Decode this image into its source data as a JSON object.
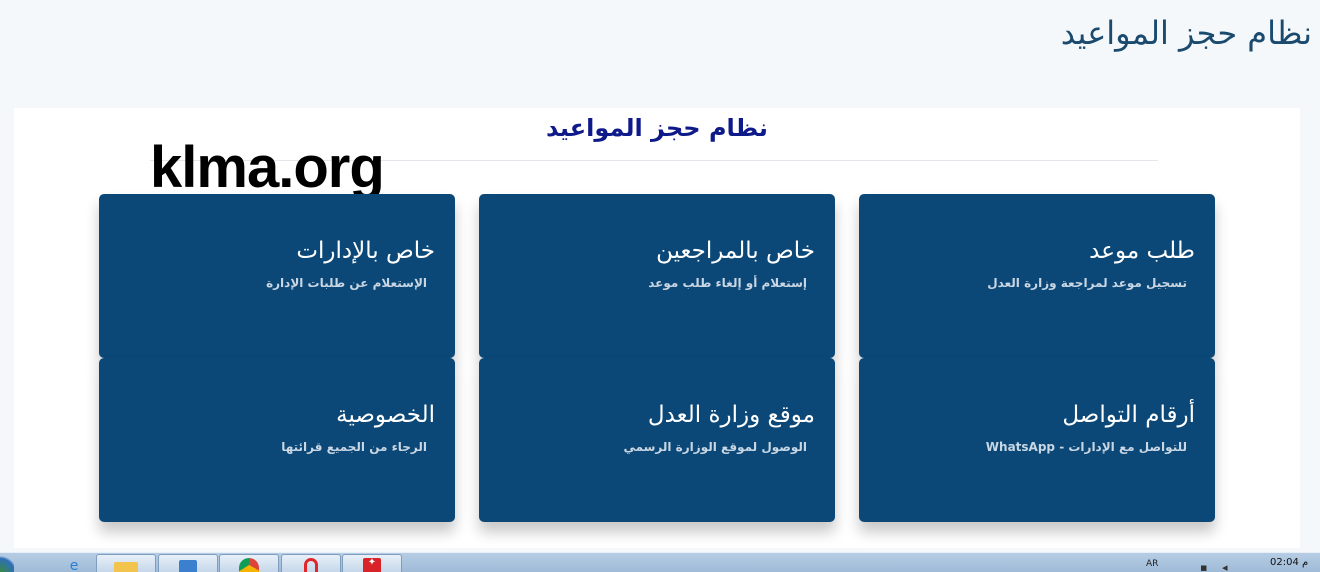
{
  "header": {
    "title": "نظام حجز المواعيد"
  },
  "panel": {
    "title": "نظام حجز المواعيد",
    "watermark": "klma.org"
  },
  "cards": [
    {
      "title": "طلب موعد",
      "subtitle": "تسجيل موعد لمراجعة وزارة العدل"
    },
    {
      "title": "خاص بالمراجعين",
      "subtitle": "إستعلام أو إلغاء طلب موعد"
    },
    {
      "title": "خاص بالإدارات",
      "subtitle": "الإستعلام عن طلبات الإدارة"
    },
    {
      "title": "أرقام التواصل",
      "subtitle": "للتواصل مع الإدارات - WhatsApp"
    },
    {
      "title": "موقع وزارة العدل",
      "subtitle": "الوصول لموقع الوزارة الرسمي"
    },
    {
      "title": "الخصوصية",
      "subtitle": "الرجاء من الجميع قرائتها"
    }
  ],
  "taskbar": {
    "language": "AR",
    "time": "02:04 م",
    "apps": [
      "internet-explorer-icon",
      "folder-icon",
      "media-player-icon",
      "chrome-icon",
      "opera-icon",
      "app-icon"
    ]
  },
  "colors": {
    "card_bg": "#0b4877",
    "panel_title": "#0f1a8a",
    "header_title": "#1a4a6e"
  }
}
